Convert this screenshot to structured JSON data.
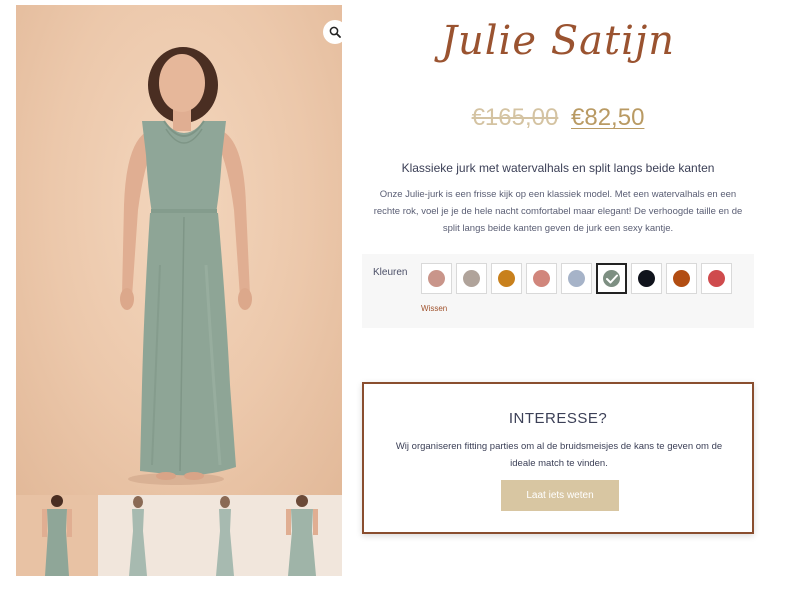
{
  "product": {
    "title": "Julie Satijn",
    "price_old": "€165,00",
    "price_new": "€82,50",
    "subtitle": "Klassieke jurk met watervalhals en split langs beide kanten",
    "description": "Onze Julie-jurk is een frisse kijk op een klassiek model. Met een watervalhals en een rechte rok, voel je je de hele nacht comfortabel maar elegant! De verhoogde taille en de split langs beide kanten geven de jurk een sexy kantje."
  },
  "colors": {
    "brand": "#9a5330",
    "price_old": "#d4c3a2",
    "price_new": "#b99a63",
    "dress": "#8fa698",
    "backdrop": "#ecc8ab",
    "box_border": "#8a4e2f",
    "button": "#d8c6a2"
  },
  "gallery": {
    "zoom_icon": "magnifier-icon",
    "thumbnail_count": 4
  },
  "variations": {
    "label": "Kleuren",
    "clear_label": "Wissen",
    "selected_index": 5,
    "swatches": [
      {
        "color": "#c9958a"
      },
      {
        "color": "#b0a39a"
      },
      {
        "color": "#c8801c"
      },
      {
        "color": "#d1867c"
      },
      {
        "color": "#a6b3c8"
      },
      {
        "color": "#7d8f82"
      },
      {
        "color": "#10131c"
      },
      {
        "color": "#b24d12"
      },
      {
        "color": "#cf4b4d"
      }
    ]
  },
  "interest": {
    "heading": "INTERESSE?",
    "text": "Wij organiseren fitting parties om al de bruidsmeisjes de kans te geven om de ideale match te vinden.",
    "button_label": "Laat iets weten"
  }
}
